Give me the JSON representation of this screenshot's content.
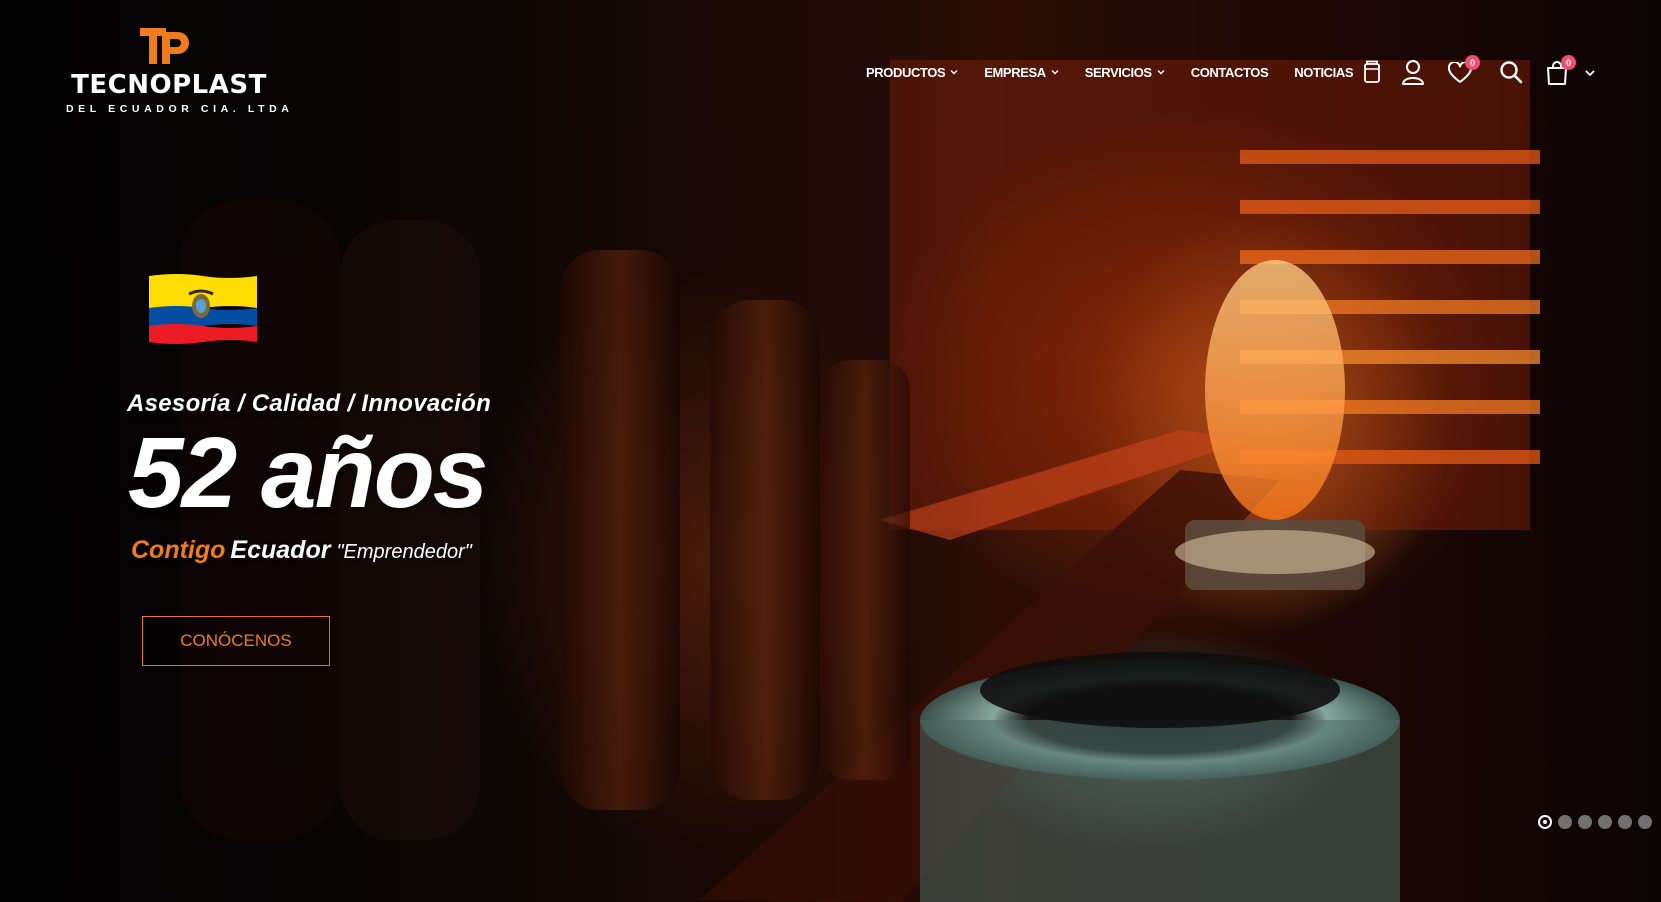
{
  "brand": {
    "name": "TECNOPLAST",
    "subtitle": "DEL ECUADOR CIA. LTDA",
    "mark": "TP",
    "accent": "#f07c1e"
  },
  "nav": {
    "items": [
      {
        "label": "PRODUCTOS",
        "has_dropdown": true
      },
      {
        "label": "EMPRESA",
        "has_dropdown": true
      },
      {
        "label": "SERVICIOS",
        "has_dropdown": true
      },
      {
        "label": "CONTACTOS",
        "has_dropdown": false
      },
      {
        "label": "NOTICIAS",
        "has_dropdown": false
      }
    ]
  },
  "header_icons": {
    "compare": {
      "icon": "compare-icon"
    },
    "account": {
      "icon": "user-icon"
    },
    "wishlist": {
      "icon": "heart-icon",
      "count": "0"
    },
    "search": {
      "icon": "search-icon"
    },
    "cart": {
      "icon": "shopping-bag-icon",
      "count": "0"
    }
  },
  "hero": {
    "flag": "ecuador-flag",
    "tagline": "Asesoría / Calidad / Innovación",
    "headline": "52 años",
    "sub_accent": "Contigo",
    "sub_bold": "Ecuador",
    "sub_quote": "\"Emprendedor\"",
    "cta_label": "CONÓCENOS",
    "slides_total": 6,
    "slide_active": 1
  },
  "colors": {
    "badge": "#f0506e",
    "text": "#ffffff",
    "flag_yellow": "#ffdd00",
    "flag_blue": "#034ea2",
    "flag_red": "#ed1c24"
  }
}
